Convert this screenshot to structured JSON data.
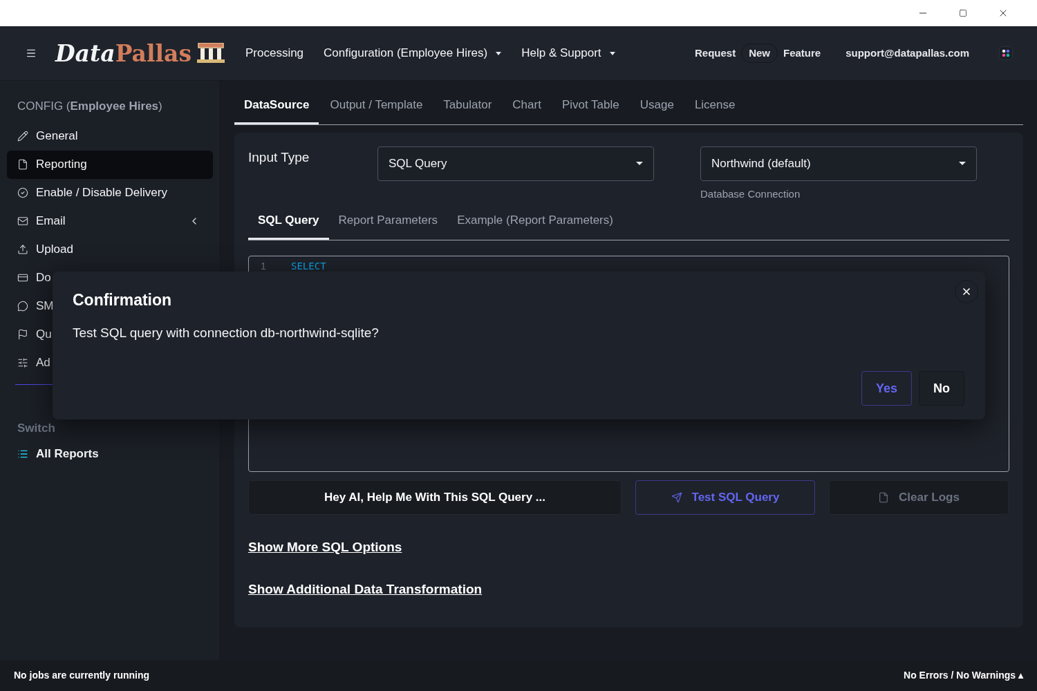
{
  "header": {
    "logo": {
      "first": "Data",
      "second": "Pallas"
    },
    "nav": [
      {
        "label": "Processing",
        "dropdown": false
      },
      {
        "label": "Configuration (Employee Hires)",
        "dropdown": true
      },
      {
        "label": "Help & Support",
        "dropdown": true
      }
    ],
    "feature_request": [
      {
        "label": "Request",
        "kind": "text"
      },
      {
        "label": "New",
        "kind": "pill"
      },
      {
        "label": "Feature",
        "kind": "text"
      }
    ],
    "email": "support@datapallas.com"
  },
  "sidebar": {
    "title": "CONFIG (**Employee Hires**)",
    "items": [
      {
        "label": "General",
        "selected": false,
        "expandable": false
      },
      {
        "label": "Reporting",
        "selected": true,
        "expandable": false
      },
      {
        "label": "Enable / Disable Delivery",
        "selected": false,
        "expandable": false
      },
      {
        "label": "Email",
        "selected": false,
        "expandable": true
      },
      {
        "label": "Upload",
        "selected": false,
        "expandable": false
      },
      {
        "label": "Do",
        "selected": false
      },
      {
        "label": "SM",
        "selected": false
      },
      {
        "label": "Qu",
        "selected": false
      },
      {
        "label": "Ad",
        "selected": false
      }
    ],
    "section": "Switch",
    "links": [
      {
        "label": "All Reports"
      }
    ]
  },
  "tabs": [
    {
      "label": "DataSource",
      "selected": true
    },
    {
      "label": "Output / Template",
      "selected": false
    },
    {
      "label": "Tabulator",
      "selected": false
    },
    {
      "label": "Chart",
      "selected": false
    },
    {
      "label": "Pivot Table",
      "selected": false
    },
    {
      "label": "Usage",
      "selected": false
    },
    {
      "label": "License",
      "selected": false
    }
  ],
  "input_type": {
    "label": "Input Type",
    "value": "SQL Query",
    "connection": "Northwind (default)",
    "connection_hint": "Database Connection"
  },
  "subtabs": [
    {
      "label": "SQL Query",
      "selected": true
    },
    {
      "label": "Report Parameters",
      "selected": false
    },
    {
      "label": "Example (Report Parameters)",
      "selected": false
    }
  ],
  "editor": {
    "lines": [
      {
        "number": "1",
        "code": "SELECT"
      }
    ]
  },
  "buttons": [
    {
      "label": "Hey AI, Help Me With This SQL Query ...",
      "kind": "plain"
    },
    {
      "label": "Test SQL Query",
      "kind": "primary"
    },
    {
      "label": "Clear Logs",
      "kind": "disabled"
    }
  ],
  "links": [
    "Show More SQL Options",
    "Show Additional Data Transformation"
  ],
  "dialog": {
    "title": "Confirmation",
    "message": "Test SQL query with connection db-northwind-sqlite?",
    "buttons": [
      {
        "label": "Yes",
        "kind": "primary"
      },
      {
        "label": "No",
        "kind": "plain"
      }
    ]
  },
  "status_bar": {
    "left": "No jobs are currently running",
    "right": "No Errors / No Warnings ▴"
  }
}
